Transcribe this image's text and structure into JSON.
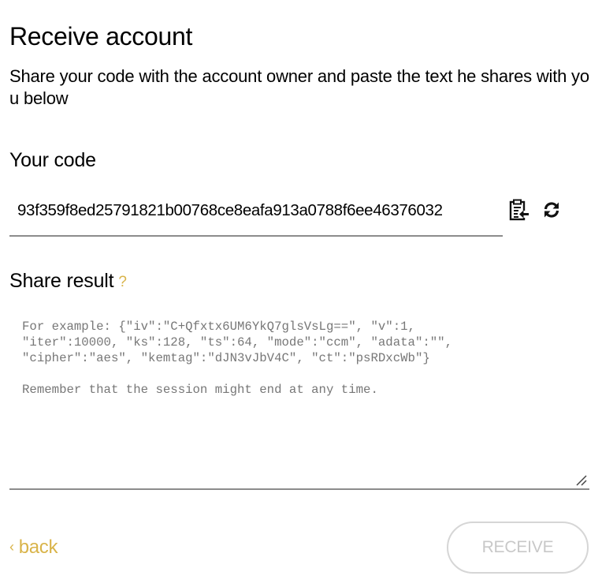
{
  "page": {
    "title": "Receive account",
    "subtitle": "Share your code with the account owner and paste the text he shares with you below"
  },
  "your_code": {
    "label": "Your code",
    "value": "93f359f8ed25791821b00768ce8eafa913a0788f6ee46376032",
    "icons": {
      "paste": "paste-from-clipboard-icon",
      "refresh": "refresh-icon"
    }
  },
  "share_result": {
    "label": "Share result",
    "help_glyph": "?",
    "value": "",
    "placeholder": "For example: {\"iv\":\"C+Qfxtx6UM6YkQ7glsVsLg==\", \"v\":1,\n\"iter\":10000, \"ks\":128, \"ts\":64, \"mode\":\"ccm\", \"adata\":\"\",\n\"cipher\":\"aes\", \"kemtag\":\"dJN3vJbV4C\", \"ct\":\"psRDxcWb\"}\n\nRemember that the session might end at any time."
  },
  "footer": {
    "back_glyph": "‹",
    "back_label": "back",
    "receive_label": "RECEIVE",
    "receive_enabled": false
  },
  "colors": {
    "accent": "#d9b44a",
    "underline": "#8c8c8c",
    "placeholder": "#777777",
    "disabled_text": "#c8c8c8",
    "disabled_border": "#d6d6d6"
  }
}
